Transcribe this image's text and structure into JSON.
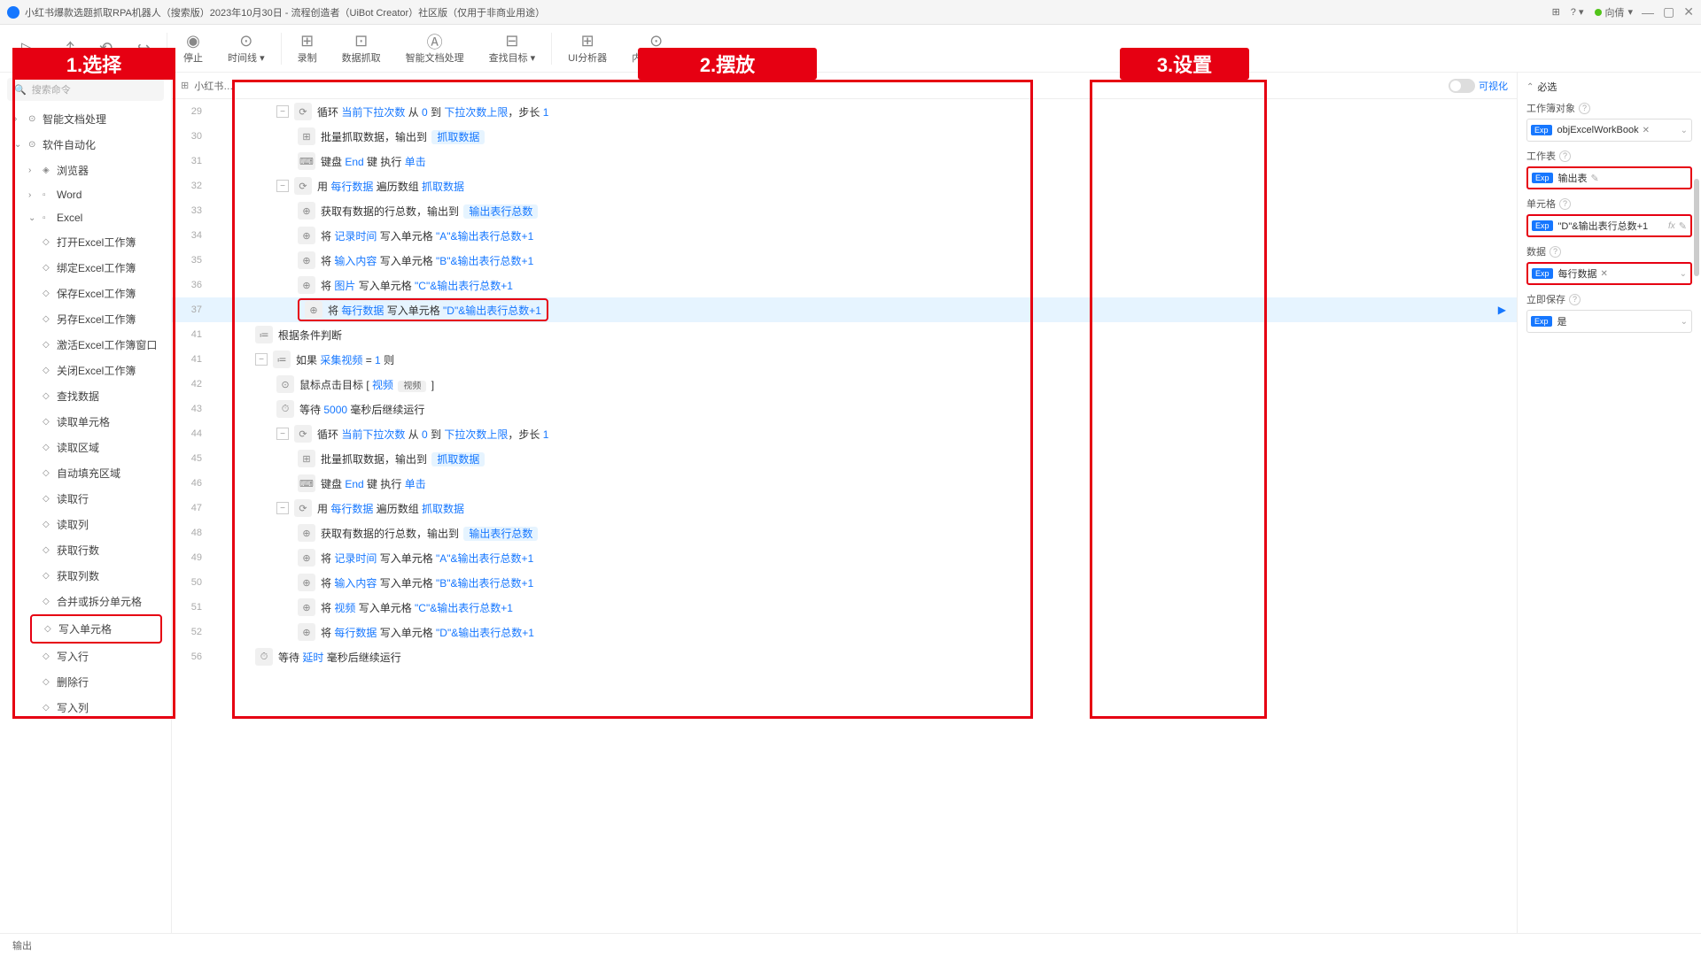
{
  "titlebar": {
    "title": "小红书爆款选题抓取RPA机器人（搜索版）2023年10月30日 - 流程创造者（UiBot Creator）社区版（仅用于非商业用途）",
    "user": "向倩"
  },
  "toolbar": {
    "items": [
      {
        "icon": "▷",
        "label": ""
      },
      {
        "icon": "⤴",
        "label": ""
      },
      {
        "icon": "⟲",
        "label": ""
      },
      {
        "icon": "↪",
        "label": ""
      },
      {
        "sep": true
      },
      {
        "icon": "◉",
        "label": "停止"
      },
      {
        "icon": "⊙",
        "label": "时间线 ▾"
      },
      {
        "sep": true
      },
      {
        "icon": "⊞",
        "label": "录制"
      },
      {
        "icon": "⊡",
        "label": "数据抓取"
      },
      {
        "icon": "Ⓐ",
        "label": "智能文档处理"
      },
      {
        "icon": "⊟",
        "label": "查找目标 ▾"
      },
      {
        "sep": true
      },
      {
        "icon": "⊞",
        "label": "UI分析器"
      },
      {
        "icon": "⊙",
        "label": "内置浏览器"
      }
    ]
  },
  "search_placeholder": "搜索命令",
  "sidebar": {
    "items": [
      {
        "lvl": 1,
        "chev": "›",
        "icon": "⊙",
        "label": "智能文档处理"
      },
      {
        "lvl": 1,
        "chev": "⌄",
        "icon": "⊙",
        "label": "软件自动化"
      },
      {
        "lvl": 2,
        "chev": "›",
        "icon": "◈",
        "label": "浏览器"
      },
      {
        "lvl": 2,
        "chev": "›",
        "icon": "▫",
        "label": "Word"
      },
      {
        "lvl": 2,
        "chev": "⌄",
        "icon": "▫",
        "label": "Excel"
      },
      {
        "lvl": 3,
        "dia": "◇",
        "label": "打开Excel工作簿"
      },
      {
        "lvl": 3,
        "dia": "◇",
        "label": "绑定Excel工作簿"
      },
      {
        "lvl": 3,
        "dia": "◇",
        "label": "保存Excel工作簿"
      },
      {
        "lvl": 3,
        "dia": "◇",
        "label": "另存Excel工作簿"
      },
      {
        "lvl": 3,
        "dia": "◇",
        "label": "激活Excel工作簿窗口"
      },
      {
        "lvl": 3,
        "dia": "◇",
        "label": "关闭Excel工作簿"
      },
      {
        "lvl": 3,
        "dia": "◇",
        "label": "查找数据"
      },
      {
        "lvl": 3,
        "dia": "◇",
        "label": "读取单元格"
      },
      {
        "lvl": 3,
        "dia": "◇",
        "label": "读取区域"
      },
      {
        "lvl": 3,
        "dia": "◇",
        "label": "自动填充区域"
      },
      {
        "lvl": 3,
        "dia": "◇",
        "label": "读取行"
      },
      {
        "lvl": 3,
        "dia": "◇",
        "label": "读取列"
      },
      {
        "lvl": 3,
        "dia": "◇",
        "label": "获取行数"
      },
      {
        "lvl": 3,
        "dia": "◇",
        "label": "获取列数"
      },
      {
        "lvl": 3,
        "dia": "◇",
        "label": "合并或拆分单元格"
      },
      {
        "lvl": 3,
        "dia": "◇",
        "label": "写入单元格",
        "active": true
      },
      {
        "lvl": 3,
        "dia": "◇",
        "label": "写入行"
      },
      {
        "lvl": 3,
        "dia": "◇",
        "label": "删除行"
      },
      {
        "lvl": 3,
        "dia": "◇",
        "label": "写入列"
      }
    ]
  },
  "tabs": {
    "crumb": "小红书…",
    "vis_label": "可视化"
  },
  "code": {
    "lines": [
      {
        "num": 29,
        "indent": 3,
        "collapse": true,
        "icon": "⟳",
        "parts": [
          {
            "t": "循环 "
          },
          {
            "t": "当前下拉次数",
            "c": "kw-link"
          },
          {
            "t": " 从 "
          },
          {
            "t": "0",
            "c": "kw-num"
          },
          {
            "t": " 到 "
          },
          {
            "t": "下拉次数上限",
            "c": "kw-link"
          },
          {
            "t": "，步长 "
          },
          {
            "t": "1",
            "c": "kw-num"
          }
        ]
      },
      {
        "num": 30,
        "indent": 4,
        "icon": "⊞",
        "parts": [
          {
            "t": "批量抓取数据，输出到 "
          },
          {
            "t": "抓取数据",
            "chip": true
          }
        ]
      },
      {
        "num": 31,
        "indent": 4,
        "icon": "⌨",
        "parts": [
          {
            "t": "键盘 "
          },
          {
            "t": "End",
            "c": "kw-link"
          },
          {
            "t": " 键 执行 "
          },
          {
            "t": "单击",
            "c": "kw-link"
          }
        ]
      },
      {
        "num": 32,
        "indent": 3,
        "collapse": true,
        "icon": "⟳",
        "parts": [
          {
            "t": "用 "
          },
          {
            "t": "每行数据",
            "c": "kw-link"
          },
          {
            "t": " 遍历数组 "
          },
          {
            "t": "抓取数据",
            "c": "kw-link"
          }
        ]
      },
      {
        "num": 33,
        "indent": 4,
        "icon": "⊕",
        "parts": [
          {
            "t": "获取有数据的行总数，输出到 "
          },
          {
            "t": "输出表行总数",
            "chip": true
          }
        ]
      },
      {
        "num": 34,
        "indent": 4,
        "icon": "⊕",
        "parts": [
          {
            "t": "将 "
          },
          {
            "t": "记录时间",
            "c": "kw-link"
          },
          {
            "t": " 写入单元格 "
          },
          {
            "t": "\"A\"&输出表行总数+1",
            "c": "kw-str"
          }
        ]
      },
      {
        "num": 35,
        "indent": 4,
        "icon": "⊕",
        "parts": [
          {
            "t": "将 "
          },
          {
            "t": "输入内容",
            "c": "kw-link"
          },
          {
            "t": " 写入单元格 "
          },
          {
            "t": "\"B\"&输出表行总数+1",
            "c": "kw-str"
          }
        ]
      },
      {
        "num": 36,
        "indent": 4,
        "icon": "⊕",
        "parts": [
          {
            "t": "将 "
          },
          {
            "t": "图片",
            "c": "kw-link"
          },
          {
            "t": " 写入单元格 "
          },
          {
            "t": "\"C\"&输出表行总数+1",
            "c": "kw-str"
          }
        ]
      },
      {
        "num": 37,
        "indent": 4,
        "icon": "⊕",
        "selected": true,
        "hl": true,
        "play": true,
        "parts": [
          {
            "t": "将 "
          },
          {
            "t": "每行数据",
            "c": "kw-link"
          },
          {
            "t": " 写入单元格 "
          },
          {
            "t": "\"D\"&输出表行总数+1",
            "c": "kw-str"
          }
        ]
      },
      {
        "num": 41,
        "indent": 2,
        "icon": "≔",
        "parts": [
          {
            "t": "根据条件判断"
          }
        ]
      },
      {
        "num": 41,
        "indent": 2,
        "collapse": true,
        "icon": "≔",
        "parts": [
          {
            "t": "如果 "
          },
          {
            "t": "采集视频",
            "c": "kw-link"
          },
          {
            "t": " = "
          },
          {
            "t": "1",
            "c": "kw-num"
          },
          {
            "t": " 则"
          }
        ]
      },
      {
        "num": 42,
        "indent": 3,
        "icon": "⊙",
        "parts": [
          {
            "t": "鼠标点击目标 "
          },
          {
            "t": "[ "
          },
          {
            "t": "视频",
            "c": "kw-link"
          },
          {
            "t": " "
          },
          {
            "t": "视频",
            "chip_gray": true
          },
          {
            "t": " ]"
          }
        ]
      },
      {
        "num": 43,
        "indent": 3,
        "icon": "⏱",
        "parts": [
          {
            "t": "等待 "
          },
          {
            "t": "5000",
            "c": "kw-link"
          },
          {
            "t": " 毫秒后继续运行"
          }
        ]
      },
      {
        "num": 44,
        "indent": 3,
        "collapse": true,
        "icon": "⟳",
        "parts": [
          {
            "t": "循环 "
          },
          {
            "t": "当前下拉次数",
            "c": "kw-link"
          },
          {
            "t": " 从 "
          },
          {
            "t": "0",
            "c": "kw-num"
          },
          {
            "t": " 到 "
          },
          {
            "t": "下拉次数上限",
            "c": "kw-link"
          },
          {
            "t": "，步长 "
          },
          {
            "t": "1",
            "c": "kw-num"
          }
        ]
      },
      {
        "num": 45,
        "indent": 4,
        "icon": "⊞",
        "parts": [
          {
            "t": "批量抓取数据，输出到 "
          },
          {
            "t": "抓取数据",
            "chip": true
          }
        ]
      },
      {
        "num": 46,
        "indent": 4,
        "icon": "⌨",
        "parts": [
          {
            "t": "键盘 "
          },
          {
            "t": "End",
            "c": "kw-link"
          },
          {
            "t": " 键 执行 "
          },
          {
            "t": "单击",
            "c": "kw-link"
          }
        ]
      },
      {
        "num": 47,
        "indent": 3,
        "collapse": true,
        "icon": "⟳",
        "parts": [
          {
            "t": "用 "
          },
          {
            "t": "每行数据",
            "c": "kw-link"
          },
          {
            "t": " 遍历数组 "
          },
          {
            "t": "抓取数据",
            "c": "kw-link"
          }
        ]
      },
      {
        "num": 48,
        "indent": 4,
        "icon": "⊕",
        "parts": [
          {
            "t": "获取有数据的行总数，输出到 "
          },
          {
            "t": "输出表行总数",
            "chip": true
          }
        ]
      },
      {
        "num": 49,
        "indent": 4,
        "icon": "⊕",
        "parts": [
          {
            "t": "将 "
          },
          {
            "t": "记录时间",
            "c": "kw-link"
          },
          {
            "t": " 写入单元格 "
          },
          {
            "t": "\"A\"&输出表行总数+1",
            "c": "kw-str"
          }
        ]
      },
      {
        "num": 50,
        "indent": 4,
        "icon": "⊕",
        "parts": [
          {
            "t": "将 "
          },
          {
            "t": "输入内容",
            "c": "kw-link"
          },
          {
            "t": " 写入单元格 "
          },
          {
            "t": "\"B\"&输出表行总数+1",
            "c": "kw-str"
          }
        ]
      },
      {
        "num": 51,
        "indent": 4,
        "icon": "⊕",
        "parts": [
          {
            "t": "将 "
          },
          {
            "t": "视频",
            "c": "kw-link"
          },
          {
            "t": " 写入单元格 "
          },
          {
            "t": "\"C\"&输出表行总数+1",
            "c": "kw-str"
          }
        ]
      },
      {
        "num": 52,
        "indent": 4,
        "icon": "⊕",
        "parts": [
          {
            "t": "将 "
          },
          {
            "t": "每行数据",
            "c": "kw-link"
          },
          {
            "t": " 写入单元格 "
          },
          {
            "t": "\"D\"&输出表行总数+1",
            "c": "kw-str"
          }
        ]
      },
      {
        "num": 56,
        "indent": 2,
        "icon": "⏱",
        "parts": [
          {
            "t": "等待 "
          },
          {
            "t": "延时",
            "c": "kw-link"
          },
          {
            "t": " 毫秒后继续运行"
          }
        ]
      }
    ]
  },
  "right": {
    "section": "必选",
    "fields": [
      {
        "label": "工作簿对象",
        "value": "objExcelWorkBook",
        "badge": "Exp",
        "closable": true,
        "dd": true
      },
      {
        "label": "工作表",
        "value": "输出表",
        "badge": "Exp",
        "red": true,
        "edit": true
      },
      {
        "label": "单元格",
        "value": "\"D\"&输出表行总数+1",
        "badge": "Exp",
        "red": true,
        "fx": true,
        "edit": true
      },
      {
        "label": "数据",
        "value": "每行数据",
        "badge": "Exp",
        "closable": true,
        "red": true,
        "dd": true
      },
      {
        "label": "立即保存",
        "value": "是",
        "badge": "Exp",
        "dd": true
      }
    ]
  },
  "bottom": {
    "output": "输出"
  },
  "banners": {
    "b1": "1.选择",
    "b2": "2.摆放",
    "b3": "3.设置"
  }
}
